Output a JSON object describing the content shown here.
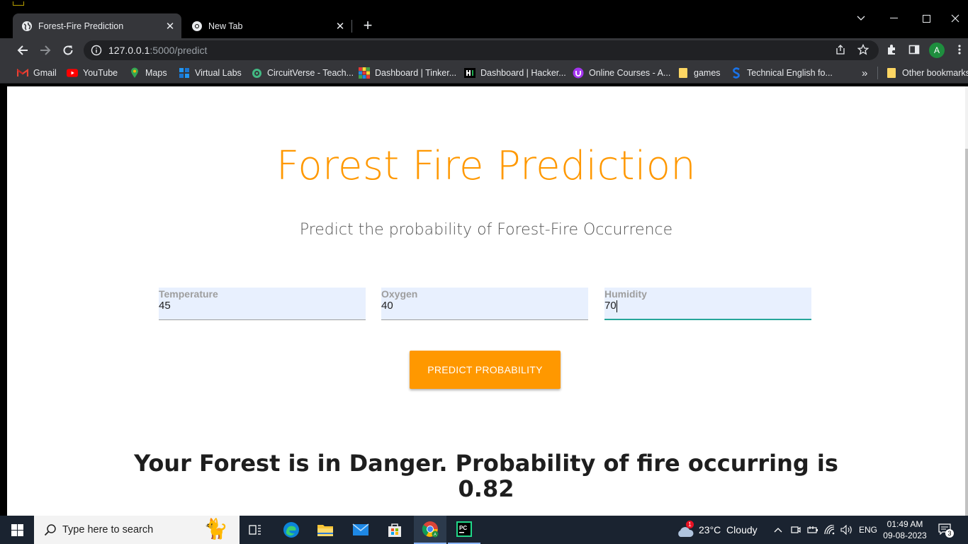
{
  "browser": {
    "tabs": [
      {
        "title": "Forest-Fire Prediction",
        "active": true
      },
      {
        "title": "New Tab",
        "active": false
      }
    ],
    "url_host": "127.0.0.1",
    "url_path": ":5000/predict",
    "profile_initial": "A",
    "bookmarks": [
      {
        "label": "Gmail",
        "icon": "gmail-icon"
      },
      {
        "label": "YouTube",
        "icon": "youtube-icon"
      },
      {
        "label": "Maps",
        "icon": "maps-icon"
      },
      {
        "label": "Virtual Labs",
        "icon": "virtual-labs-icon"
      },
      {
        "label": "CircuitVerse - Teach...",
        "icon": "circuitverse-icon"
      },
      {
        "label": "Dashboard | Tinker...",
        "icon": "tinkercad-icon"
      },
      {
        "label": "Dashboard | Hacker...",
        "icon": "hackerrank-icon"
      },
      {
        "label": "Online Courses - A...",
        "icon": "udemy-icon"
      },
      {
        "label": "games",
        "icon": "folder-icon"
      },
      {
        "label": "Technical English fo...",
        "icon": "s-icon"
      }
    ],
    "other_bookmarks": "Other bookmarks"
  },
  "page": {
    "title": "Forest Fire Prediction",
    "subtitle": "Predict the probability of Forest-Fire Occurrence",
    "fields": [
      {
        "label": "Temperature",
        "value": "45"
      },
      {
        "label": "Oxygen",
        "value": "40"
      },
      {
        "label": "Humidity",
        "value": "70"
      }
    ],
    "button_label": "PREDICT PROBABILITY",
    "result_line1": "Your Forest is in Danger. Probability of fire occurring is",
    "result_line2": "0.82"
  },
  "taskbar": {
    "search_placeholder": "Type here to search",
    "weather_badge": "1",
    "weather": "23°C  Cloudy",
    "language": "ENG",
    "time": "01:49 AM",
    "date": "09-08-2023",
    "notifications": "3"
  },
  "colors": {
    "accent": "#ff9800",
    "focus_underline": "#26a69a",
    "field_bg": "#e8f0fe"
  }
}
